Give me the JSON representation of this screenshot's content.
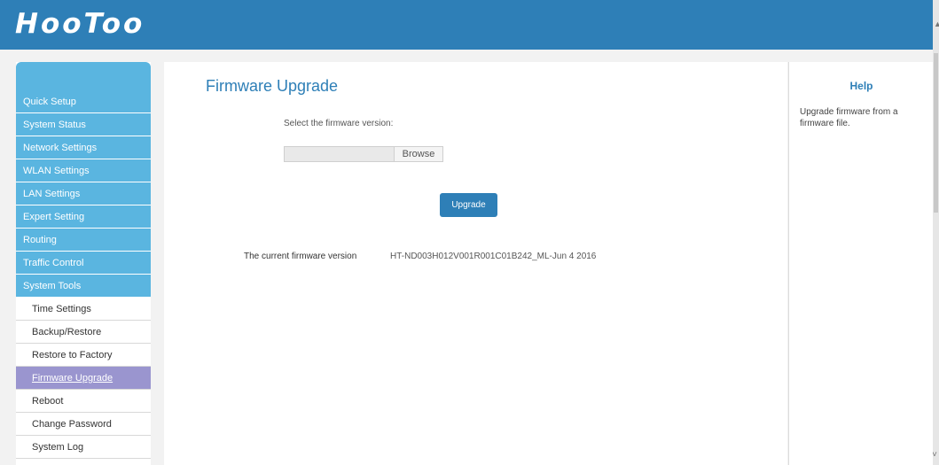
{
  "header": {
    "logo": "HooToo"
  },
  "sidebar": {
    "items": [
      {
        "label": "Quick Setup"
      },
      {
        "label": "System Status"
      },
      {
        "label": "Network Settings"
      },
      {
        "label": "WLAN Settings"
      },
      {
        "label": "LAN Settings"
      },
      {
        "label": "Expert Setting"
      },
      {
        "label": "Routing"
      },
      {
        "label": "Traffic Control"
      },
      {
        "label": "System Tools"
      }
    ],
    "subitems": [
      {
        "label": "Time Settings"
      },
      {
        "label": "Backup/Restore"
      },
      {
        "label": "Restore to Factory"
      },
      {
        "label": "Firmware Upgrade",
        "active": true
      },
      {
        "label": "Reboot"
      },
      {
        "label": "Change Password"
      },
      {
        "label": "System Log"
      }
    ]
  },
  "main": {
    "title": "Firmware Upgrade",
    "select_label": "Select the firmware version:",
    "file_value": "",
    "browse_label": "Browse",
    "upgrade_label": "Upgrade",
    "current_version_label": "The current firmware version",
    "current_version_value": "HT-ND003H012V001R001C01B242_ML-Jun 4 2016"
  },
  "help": {
    "title": "Help",
    "text": "Upgrade firmware from a firmware file."
  },
  "colors": {
    "header_bg": "#2e7fb7",
    "menu_bg": "#5ab5e0",
    "active_item_bg": "#9a95cf",
    "button_bg": "#2e7fb7"
  }
}
